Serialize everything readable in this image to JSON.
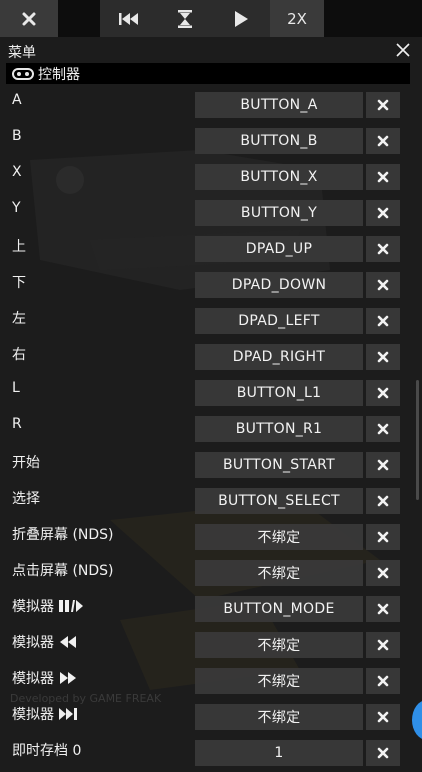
{
  "toolbar": {
    "close_icon": "close-icon",
    "rewind_icon": "rewind-icon",
    "pause_icon": "hourglass-icon",
    "play_icon": "play-icon",
    "speed_label": "2X"
  },
  "menu": {
    "title": "菜单",
    "section_label": "控制器",
    "section_icon": "gamepad-icon"
  },
  "bindings": [
    {
      "label": "A",
      "value": "BUTTON_A"
    },
    {
      "label": "B",
      "value": "BUTTON_B"
    },
    {
      "label": "X",
      "value": "BUTTON_X"
    },
    {
      "label": "Y",
      "value": "BUTTON_Y"
    },
    {
      "label": "上",
      "value": "DPAD_UP"
    },
    {
      "label": "下",
      "value": "DPAD_DOWN"
    },
    {
      "label": "左",
      "value": "DPAD_LEFT"
    },
    {
      "label": "右",
      "value": "DPAD_RIGHT"
    },
    {
      "label": "L",
      "value": "BUTTON_L1"
    },
    {
      "label": "R",
      "value": "BUTTON_R1"
    },
    {
      "label": "开始",
      "value": "BUTTON_START"
    },
    {
      "label": "选择",
      "value": "BUTTON_SELECT"
    },
    {
      "label": "折叠屏幕 (NDS)",
      "value": "不绑定"
    },
    {
      "label": "点击屏幕 (NDS)",
      "value": "不绑定"
    },
    {
      "label": "模拟器",
      "value": "BUTTON_MODE",
      "icon": "play-pause-icon"
    },
    {
      "label": "模拟器",
      "value": "不绑定",
      "icon": "rewind-icon"
    },
    {
      "label": "模拟器",
      "value": "不绑定",
      "icon": "fast-forward-icon"
    },
    {
      "label": "模拟器",
      "value": "不绑定",
      "icon": "skip-forward-icon"
    },
    {
      "label": "即时存档 0",
      "value": "1"
    }
  ],
  "background_text": "Developed by GAME FREAK",
  "colors": {
    "background": "#1c1c1c",
    "toolbar": "#0d0d0d",
    "button": "#3a3a3a",
    "fab": "#2f8fe8"
  }
}
